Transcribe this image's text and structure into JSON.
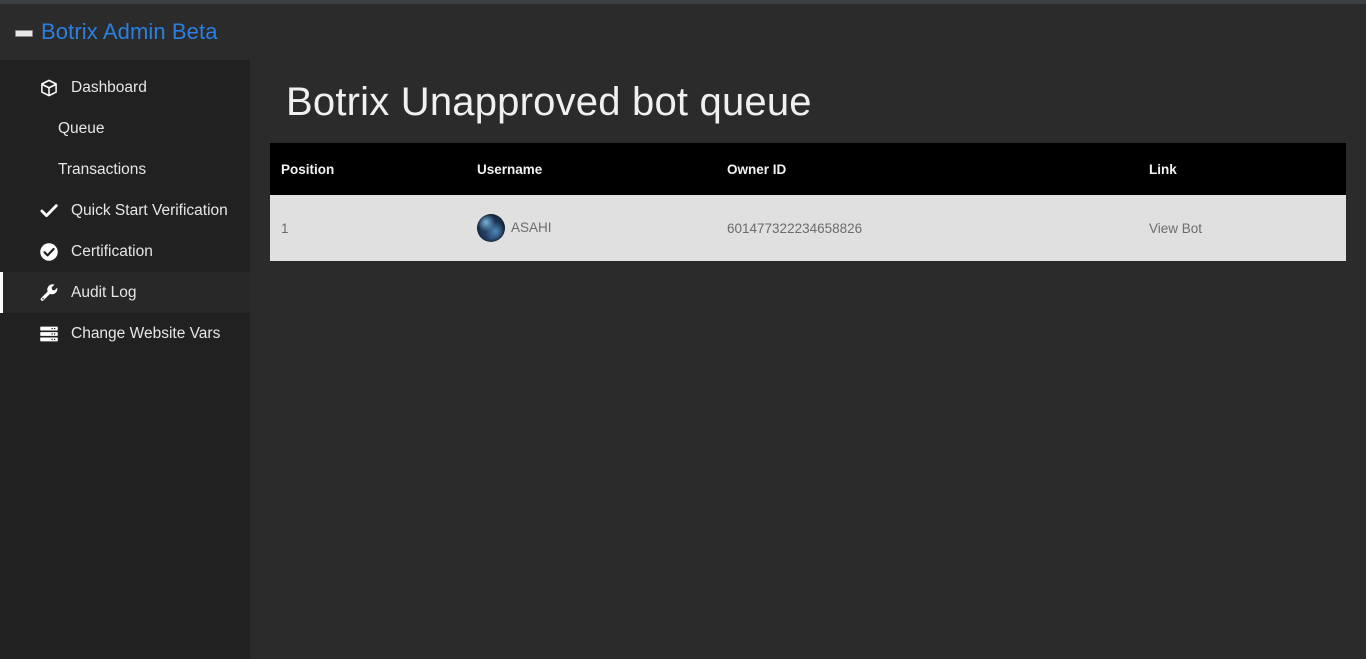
{
  "window": {
    "background_color": "#2b2b2b",
    "top_strip_color": "#3b3e43"
  },
  "navbar": {
    "brand_label": "Botrix Admin Beta",
    "brand_color": "#2b7fe0",
    "brand_icon": "minimize-bar-icon"
  },
  "sidebar": {
    "background_color": "#212121",
    "active_indicator_color": "#ffffff",
    "items": [
      {
        "label": "Dashboard",
        "icon": "box-icon",
        "sub": false,
        "active": false
      },
      {
        "label": "Queue",
        "icon": "",
        "sub": true,
        "active": false
      },
      {
        "label": "Transactions",
        "icon": "",
        "sub": true,
        "active": false
      },
      {
        "label": "Quick Start Verification",
        "icon": "check-icon",
        "sub": false,
        "active": false
      },
      {
        "label": "Certification",
        "icon": "check-circle-icon",
        "sub": false,
        "active": false
      },
      {
        "label": "Audit Log",
        "icon": "wrench-icon",
        "sub": false,
        "active": true
      },
      {
        "label": "Change Website Vars",
        "icon": "server-icon",
        "sub": false,
        "active": false
      }
    ]
  },
  "main": {
    "page_title": "Botrix Unapproved bot queue",
    "table": {
      "header_background": "#000000",
      "row_background": "#e0e0e0",
      "columns": [
        "Position",
        "Username",
        "Owner ID",
        "Link"
      ],
      "rows": [
        {
          "position": "1",
          "username": "ASAHI",
          "avatar": "user-avatar",
          "owner_id": "601477322234658826",
          "link_label": "View Bot"
        }
      ]
    }
  }
}
